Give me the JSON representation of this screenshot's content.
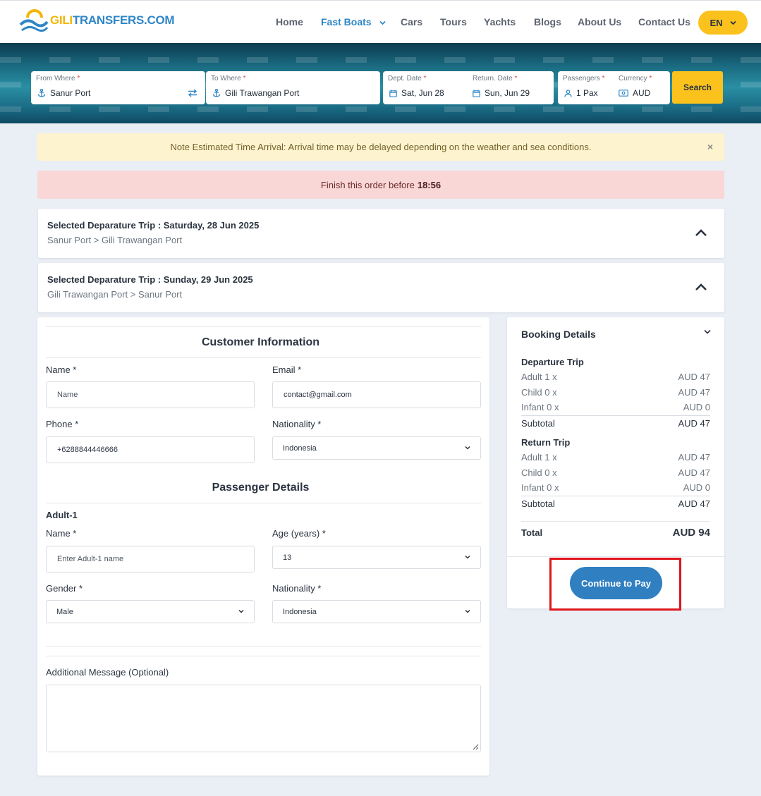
{
  "brand": {
    "logo_text_a": "GILI",
    "logo_text_b": "TRANSFERS.COM"
  },
  "nav": {
    "home": "Home",
    "fast_boats": "Fast Boats",
    "cars": "Cars",
    "tours": "Tours",
    "yachts": "Yachts",
    "blogs": "Blogs",
    "about": "About Us",
    "contact": "Contact Us",
    "lang": "EN"
  },
  "search": {
    "from_label": "From Where",
    "from_value": "Sanur Port",
    "to_label": "To Where",
    "to_value": "Gili Trawangan Port",
    "dept_label": "Dept. Date",
    "dept_value": "Sat, Jun 28",
    "return_label": "Return. Date",
    "return_value": "Sun, Jun 29",
    "pax_label": "Passengers",
    "pax_value": "1 Pax",
    "currency_label": "Currency",
    "currency_value": "AUD",
    "required_mark": "*",
    "button": "Search"
  },
  "alerts": {
    "note": "Note Estimated Time Arrival: Arrival time may be delayed depending on the weather and sea conditions.",
    "close": "×",
    "timer_prefix": "Finish this order before",
    "timer_time": "18:56"
  },
  "trips": [
    {
      "title": "Selected Deparature Trip : Saturday, 28 Jun 2025",
      "route": "Sanur Port > Gili Trawangan Port"
    },
    {
      "title": "Selected Deparature Trip : Sunday, 29 Jun 2025",
      "route": "Gili Trawangan Port > Sanur Port"
    }
  ],
  "customer": {
    "heading": "Customer Information",
    "name_label": "Name *",
    "name_placeholder": "Name",
    "email_label": "Email *",
    "email_value": "contact@gmail.com",
    "phone_label": "Phone *",
    "phone_value": "+6288844446666",
    "nationality_label": "Nationality *",
    "nationality_value": "Indonesia"
  },
  "passenger": {
    "heading": "Passenger Details",
    "adult_heading": "Adult-1",
    "name_label": "Name *",
    "name_placeholder": "Enter Adult-1 name",
    "age_label": "Age (years) *",
    "age_value": "13",
    "gender_label": "Gender *",
    "gender_value": "Male",
    "nationality_label": "Nationality *",
    "nationality_value": "Indonesia"
  },
  "message": {
    "label": "Additional Message (Optional)"
  },
  "booking": {
    "title": "Booking Details",
    "departure": {
      "heading": "Departure Trip",
      "rows": [
        {
          "label": "Adult 1 x",
          "value": "AUD 47"
        },
        {
          "label": "Child 0 x",
          "value": "AUD 47"
        },
        {
          "label": "Infant 0 x",
          "value": "AUD 0"
        }
      ],
      "subtotal_label": "Subtotal",
      "subtotal_value": "AUD 47"
    },
    "return": {
      "heading": "Return Trip",
      "rows": [
        {
          "label": "Adult 1 x",
          "value": "AUD 47"
        },
        {
          "label": "Child 0 x",
          "value": "AUD 47"
        },
        {
          "label": "Infant 0 x",
          "value": "AUD 0"
        }
      ],
      "subtotal_label": "Subtotal",
      "subtotal_value": "AUD 47"
    },
    "total_label": "Total",
    "total_value": "AUD 94",
    "pay_button": "Continue to Pay"
  },
  "colors": {
    "primary": "#2f86c7",
    "accent": "#fbc21d",
    "highlight": "#e0151b"
  }
}
